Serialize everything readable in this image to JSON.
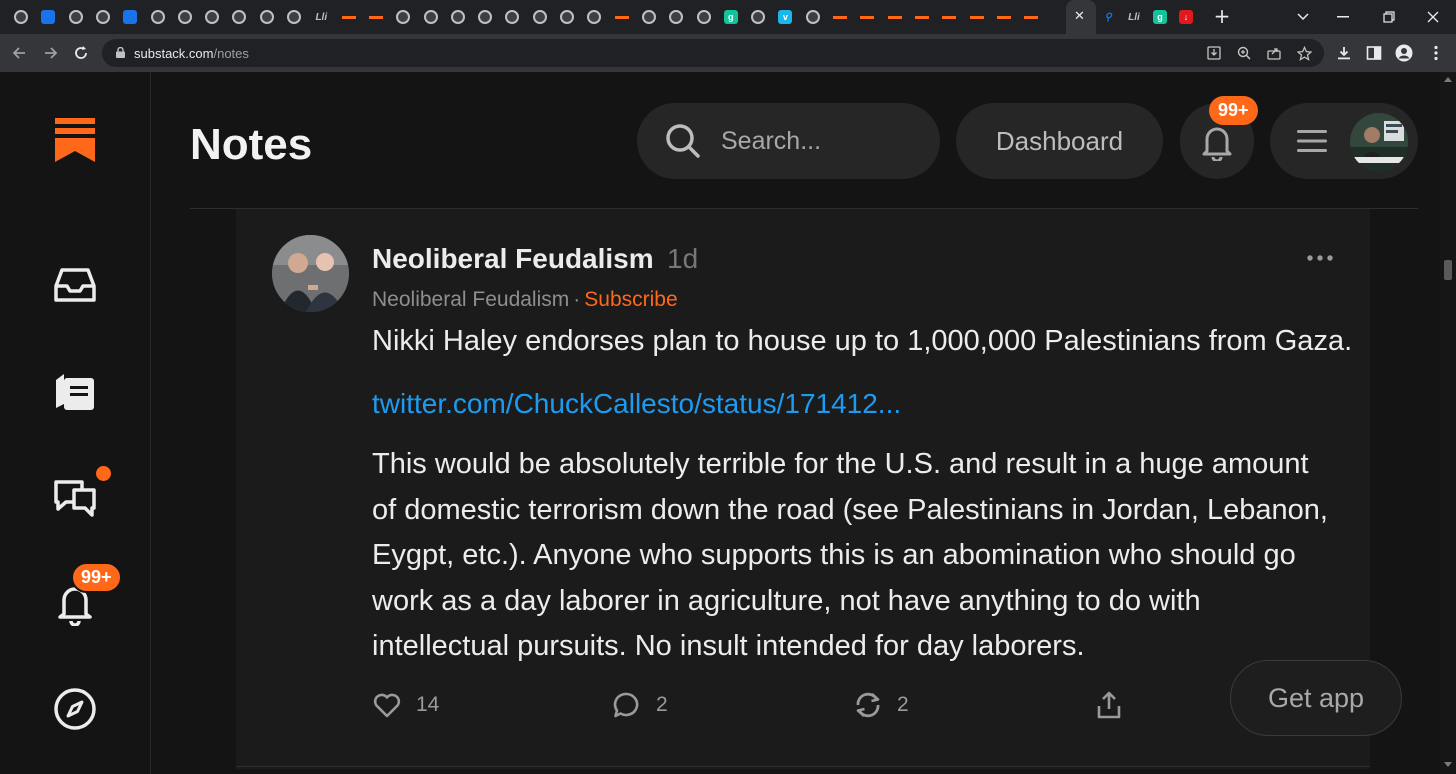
{
  "browser": {
    "tabs": [
      {
        "icon": "globe-icon"
      },
      {
        "icon": "shield-icon"
      },
      {
        "icon": "globe-icon"
      },
      {
        "icon": "globe-icon"
      },
      {
        "icon": "graduation-cap-icon"
      },
      {
        "icon": "globe-icon"
      },
      {
        "icon": "globe-icon"
      },
      {
        "icon": "globe-icon"
      },
      {
        "icon": "globe-icon"
      },
      {
        "icon": "globe-icon"
      },
      {
        "icon": "globe-icon"
      },
      {
        "icon": "library-icon"
      },
      {
        "icon": "substack-icon"
      },
      {
        "icon": "substack-icon"
      },
      {
        "icon": "globe-icon"
      },
      {
        "icon": "globe-icon"
      },
      {
        "icon": "globe-icon"
      },
      {
        "icon": "globe-icon"
      },
      {
        "icon": "globe-icon"
      },
      {
        "icon": "globe-icon"
      },
      {
        "icon": "globe-icon"
      },
      {
        "icon": "globe-icon"
      },
      {
        "icon": "substack-icon"
      },
      {
        "icon": "globe-icon"
      },
      {
        "icon": "globe-icon"
      },
      {
        "icon": "globe-icon"
      },
      {
        "icon": "grammarly-icon"
      },
      {
        "icon": "globe-icon"
      },
      {
        "icon": "vimeo-icon"
      },
      {
        "icon": "globe-icon"
      },
      {
        "icon": "substack-icon"
      },
      {
        "icon": "substack-icon"
      },
      {
        "icon": "substack-icon"
      },
      {
        "icon": "substack-icon"
      },
      {
        "icon": "substack-icon"
      },
      {
        "icon": "substack-icon"
      },
      {
        "icon": "substack-icon"
      },
      {
        "icon": "substack-icon"
      }
    ],
    "active_tab_close": "✕",
    "trailing_tabs": [
      {
        "icon": "search-favicon-icon"
      },
      {
        "icon": "library-icon"
      },
      {
        "icon": "grammarly-icon"
      },
      {
        "icon": "red-app-icon"
      }
    ],
    "new_tab": "+",
    "url_host": "substack.com",
    "url_path": "/notes"
  },
  "sidebar": {
    "items": [
      {
        "name": "inbox"
      },
      {
        "name": "reader"
      },
      {
        "name": "chat",
        "has_dot": true
      },
      {
        "name": "activity",
        "badge": "99+"
      },
      {
        "name": "explore"
      }
    ]
  },
  "header": {
    "title": "Notes",
    "search_placeholder": "Search...",
    "dashboard_label": "Dashboard",
    "notification_badge": "99+"
  },
  "note": {
    "author": "Neoliberal Feudalism",
    "time": "1d",
    "publication": "Neoliberal Feudalism",
    "separator": "·",
    "subscribe_label": "Subscribe",
    "headline": "Nikki Haley endorses plan to house up to 1,000,000 Palestinians from Gaza.",
    "link_text": "twitter.com/ChuckCallesto/status/171412...",
    "body": "This would be absolutely terrible for the U.S. and result in a huge amount of domestic terrorism down the road (see Palestinians in Jordan, Lebanon, Eygpt, etc.). Anyone who supports this is an abomination who should go work as a day laborer in agriculture, not have anything to do with intellectual pursuits. No insult intended for day laborers.",
    "likes": "14",
    "comments": "2",
    "restacks": "2"
  },
  "get_app_label": "Get app",
  "colors": {
    "accent": "#ff6719",
    "link": "#1d9bf0",
    "background": "#141414"
  }
}
